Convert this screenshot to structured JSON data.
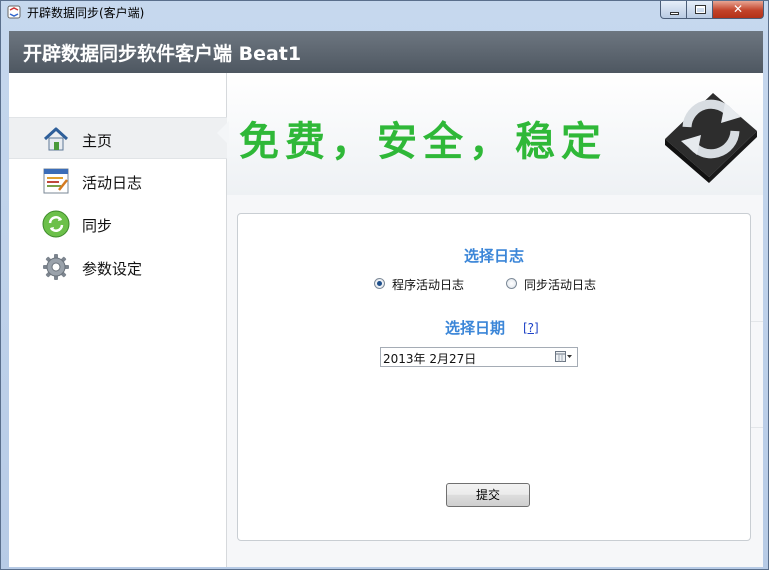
{
  "window": {
    "title": "开辟数据同步(客户端)",
    "close_glyph": "✕"
  },
  "header": {
    "title": "开辟数据同步软件客户端 Beat1"
  },
  "sidebar": {
    "items": [
      {
        "label": "主页",
        "icon": "home-icon",
        "active": true
      },
      {
        "label": "活动日志",
        "icon": "log-icon",
        "active": false
      },
      {
        "label": "同步",
        "icon": "sync-icon",
        "active": false
      },
      {
        "label": "参数设定",
        "icon": "gear-icon",
        "active": false
      }
    ]
  },
  "banner": {
    "slogan": "免费，安全，稳定",
    "slogan_color": "#2fb838",
    "logo_icon": "sync-logo-icon"
  },
  "form": {
    "log_section_title": "选择日志",
    "radio_options": [
      {
        "label": "程序活动日志",
        "checked": true
      },
      {
        "label": "同步活动日志",
        "checked": false
      }
    ],
    "date_section_title": "选择日期",
    "help_link": "[?]",
    "date_value": "2013年  2月27日",
    "submit_label": "提交",
    "accent_color": "#3b86d8"
  }
}
